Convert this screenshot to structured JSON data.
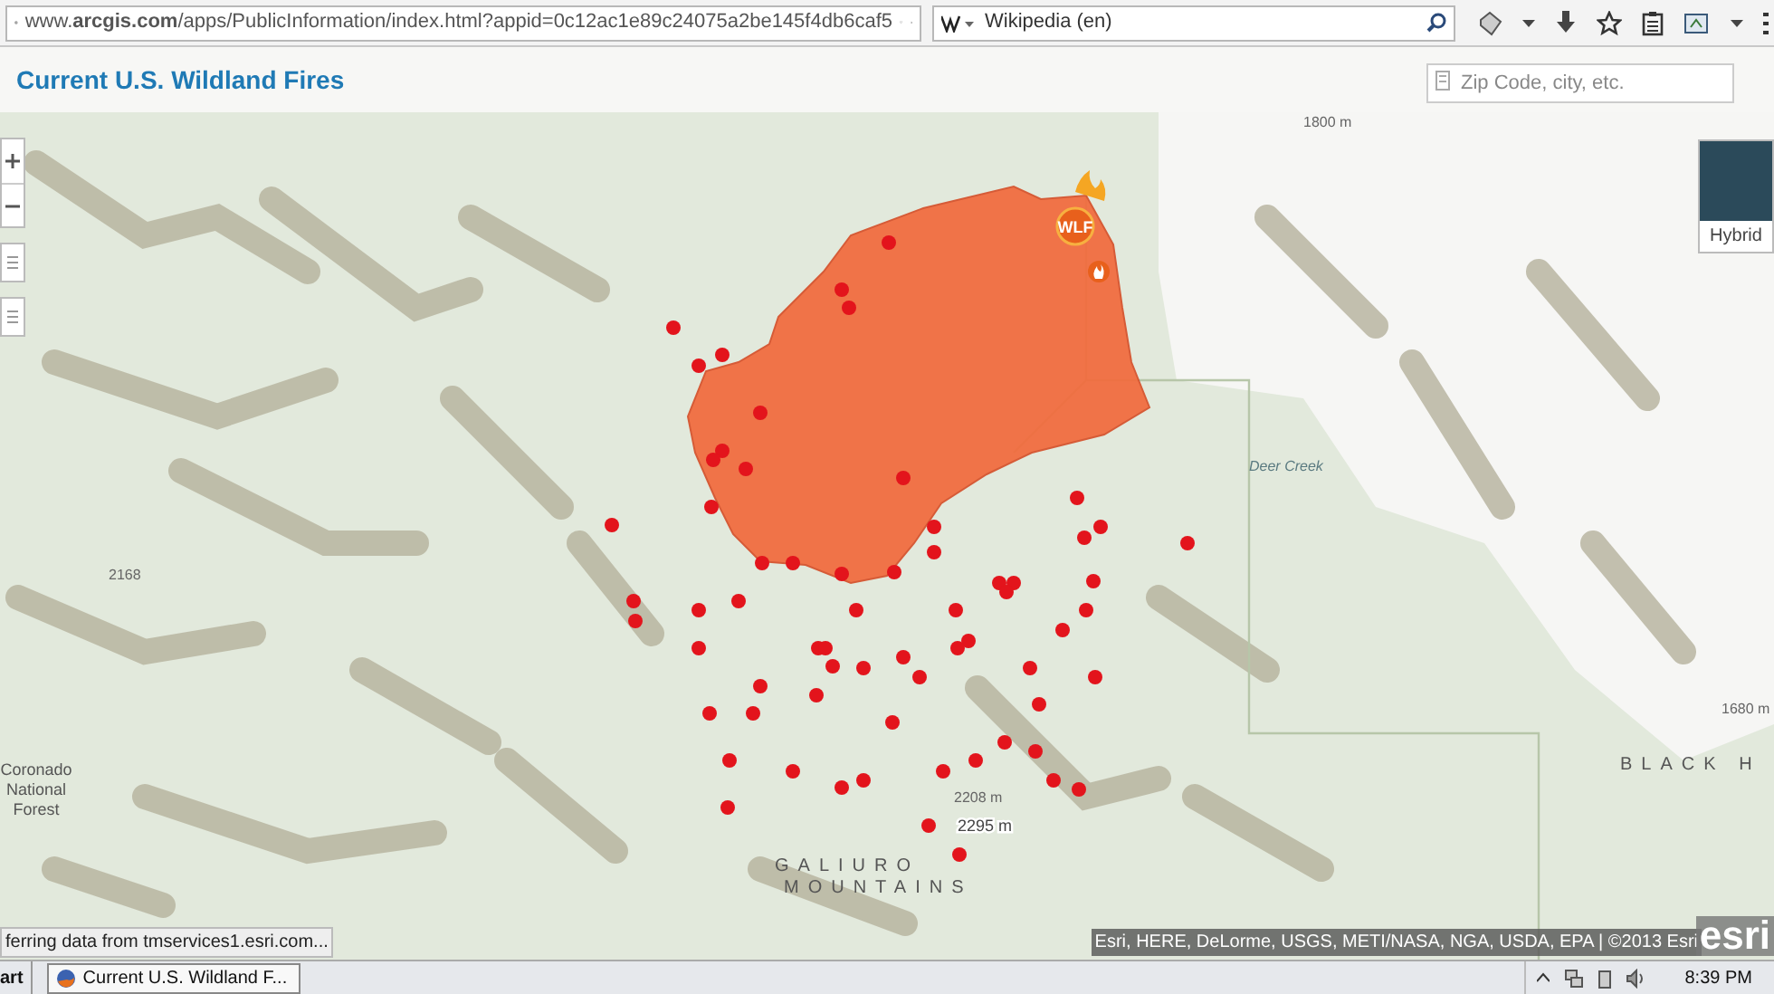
{
  "browser": {
    "url": "www.**arcgis.com**/apps/PublicInformation/index.html?appid=0c12ac1e89c24075a2be145f4db6caf5",
    "search_engine": "Wikipedia (en)"
  },
  "header": {
    "title": "Current U.S. Wildland Fires",
    "search": {
      "placeholder": "Zip Code, city, etc."
    }
  },
  "map": {
    "basemap": {
      "label": "Hybrid"
    },
    "fire_marker": "WLF",
    "labels": [
      {
        "text": "Coronado National Forest",
        "kind": "area"
      },
      {
        "text": "GALIURO",
        "kind": "range"
      },
      {
        "text": "MOUNTAINS",
        "kind": "range"
      },
      {
        "text": "BLACK H",
        "kind": "range"
      },
      {
        "text": "2295 m",
        "kind": "peak"
      },
      {
        "text": "2208 m",
        "kind": "elevation"
      },
      {
        "text": "1680 m",
        "kind": "elevation"
      },
      {
        "text": "2168",
        "kind": "elevation"
      },
      {
        "text": "1800 m",
        "kind": "elevation"
      },
      {
        "text": "Deer Creek",
        "kind": "water"
      }
    ],
    "attribution": "Esri, HERE, DeLorme, USGS, METI/NASA, NGA, USDA, EPA | ©2013 Esri",
    "logo": "esri"
  },
  "status_bar": "ferring data from tmservices1.esri.com...",
  "taskbar": {
    "start": "art",
    "tasks": [
      {
        "label": "Current U.S. Wildland F...",
        "selected": true
      }
    ],
    "clock": "8:39 PM"
  }
}
